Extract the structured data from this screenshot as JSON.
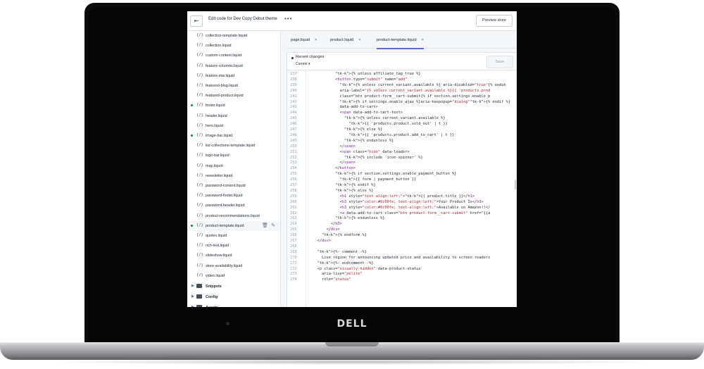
{
  "device": {
    "brand": "DELL"
  },
  "topbar": {
    "exit_icon": "exit-icon",
    "title": "Edit code for Dev Copy Debut theme",
    "more": "•••",
    "preview_label": "Preview store"
  },
  "sidebar": {
    "files": [
      {
        "icon": "{/}",
        "label": "collection-template.liquid",
        "modified": false
      },
      {
        "icon": "{/}",
        "label": "collection.liquid",
        "modified": false
      },
      {
        "icon": "{/}",
        "label": "custom-content.liquid",
        "modified": false
      },
      {
        "icon": "{/}",
        "label": "feature-columns.liquid",
        "modified": false
      },
      {
        "icon": "{/}",
        "label": "feature-row.liquid",
        "modified": false
      },
      {
        "icon": "{/}",
        "label": "featured-blog.liquid",
        "modified": false
      },
      {
        "icon": "{/}",
        "label": "featured-product.liquid",
        "modified": false
      },
      {
        "icon": "{/}",
        "label": "footer.liquid",
        "modified": true
      },
      {
        "icon": "{/}",
        "label": "header.liquid",
        "modified": false
      },
      {
        "icon": "{/}",
        "label": "hero.liquid",
        "modified": false
      },
      {
        "icon": "{/}",
        "label": "image-bar.liquid",
        "modified": true
      },
      {
        "icon": "{/}",
        "label": "list-collections-template.liquid",
        "modified": false
      },
      {
        "icon": "{/}",
        "label": "logo-bar.liquid",
        "modified": false
      },
      {
        "icon": "{/}",
        "label": "map.liquid",
        "modified": false
      },
      {
        "icon": "{/}",
        "label": "newsletter.liquid",
        "modified": false
      },
      {
        "icon": "{/}",
        "label": "password-content.liquid",
        "modified": false
      },
      {
        "icon": "{/}",
        "label": "password-footer.liquid",
        "modified": false
      },
      {
        "icon": "{/}",
        "label": "password-header.liquid",
        "modified": false
      },
      {
        "icon": "{/}",
        "label": "product-recommendations.liquid",
        "modified": false
      },
      {
        "icon": "{/}",
        "label": "product-template.liquid",
        "modified": true,
        "active": true
      },
      {
        "icon": "{/}",
        "label": "quotes.liquid",
        "modified": false
      },
      {
        "icon": "{/}",
        "label": "rich-text.liquid",
        "modified": false
      },
      {
        "icon": "{/}",
        "label": "slideshow.liquid",
        "modified": false
      },
      {
        "icon": "{/}",
        "label": "store-availability.liquid",
        "modified": false
      },
      {
        "icon": "{/}",
        "label": "video.liquid",
        "modified": false
      }
    ],
    "folders": [
      {
        "label": "Snippets"
      },
      {
        "label": "Config"
      },
      {
        "label": "Assets"
      }
    ]
  },
  "tabs": [
    {
      "label": "page.liquid",
      "close": "×"
    },
    {
      "label": "product.liquid",
      "close": "×"
    },
    {
      "label": "product-template.liquid",
      "close": "×",
      "active": true
    }
  ],
  "editor": {
    "recent_changes": "Recent changes",
    "version_select": "Current ▾",
    "save_label": "Save",
    "lines": [
      {
        "n": "237",
        "t": "            {% unless affiliate_tag_true %}"
      },
      {
        "n": "238",
        "t": "            <button type=\"submit\" name=\"add\""
      },
      {
        "n": "239",
        "t": "              {% unless current_variant.available %} aria-disabled=\"true\"{% endun"
      },
      {
        "n": "240",
        "t": "              aria-label=\"{% unless current_variant.available %}{{ 'products.prod"
      },
      {
        "n": "241",
        "t": "              class=\"btn product-form__cart-submit{% if section.settings.enable_p"
      },
      {
        "n": "242",
        "t": "              {% if settings.enable_ajax %}aria-haspopup=\"dialog\"{% endif %}"
      },
      {
        "n": "243",
        "t": "              data-add-to-cart>"
      },
      {
        "n": "244",
        "t": "              <span data-add-to-cart-text>"
      },
      {
        "n": "245",
        "t": "                {% unless current_variant.available %}"
      },
      {
        "n": "246",
        "t": "                  {{ 'products.product.sold_out' | t }}"
      },
      {
        "n": "247",
        "t": "                {% else %}"
      },
      {
        "n": "248",
        "t": "                  {{ 'products.product.add_to_cart' | t }}"
      },
      {
        "n": "249",
        "t": "                {% endunless %}"
      },
      {
        "n": "250",
        "t": "              </span>"
      },
      {
        "n": "251",
        "t": "              <span class=\"hide\" data-loader>"
      },
      {
        "n": "252",
        "t": "                {% include 'icon-spinner' %}"
      },
      {
        "n": "253",
        "t": "              </span>"
      },
      {
        "n": "254",
        "t": "            </button>"
      },
      {
        "n": "255",
        "t": "            {% if section.settings.enable_payment_button %}"
      },
      {
        "n": "256",
        "t": "              {{ form | payment_button }}"
      },
      {
        "n": "257",
        "t": "            {% endif %}"
      },
      {
        "n": "258",
        "t": "            {% else %}"
      },
      {
        "n": "259",
        "t": "              <h1 style=\"text-align:left;\">{{ product.title }}</h1>"
      },
      {
        "n": "260",
        "t": "              <h3 style=\"color:#6c00fe; text-align:left;\">Your Product Is</h3>"
      },
      {
        "n": "261",
        "t": "              <h3 style=\"color:#6c00fe; text-align:left;\">Available on Amazon!!</"
      },
      {
        "n": "262",
        "t": "              <a data-add-to-cart class=\"btn product-form__cart-submit\" href=\"{{a"
      },
      {
        "n": "263",
        "t": "            {% endunless %}"
      },
      {
        "n": "264",
        "t": "          </h3>"
      },
      {
        "n": "265",
        "t": "        </div>"
      },
      {
        "n": "266",
        "t": "      {% endform %}"
      },
      {
        "n": "267",
        "t": "    </div>"
      },
      {
        "n": "268",
        "t": ""
      },
      {
        "n": "269",
        "t": "    {%- comment -%}"
      },
      {
        "n": "270",
        "t": "      Live region for announcing updated price and availability to screen readers"
      },
      {
        "n": "271",
        "t": "    {%- endcomment -%}"
      },
      {
        "n": "272",
        "t": "    <p class=\"visually-hidden\" data-product-status"
      },
      {
        "n": "273",
        "t": "      aria-live=\"polite\""
      },
      {
        "n": "274",
        "t": "      role=\"status\""
      }
    ]
  },
  "colors": {
    "accent": "#5c6ac4",
    "modified_dot": "#108043"
  }
}
